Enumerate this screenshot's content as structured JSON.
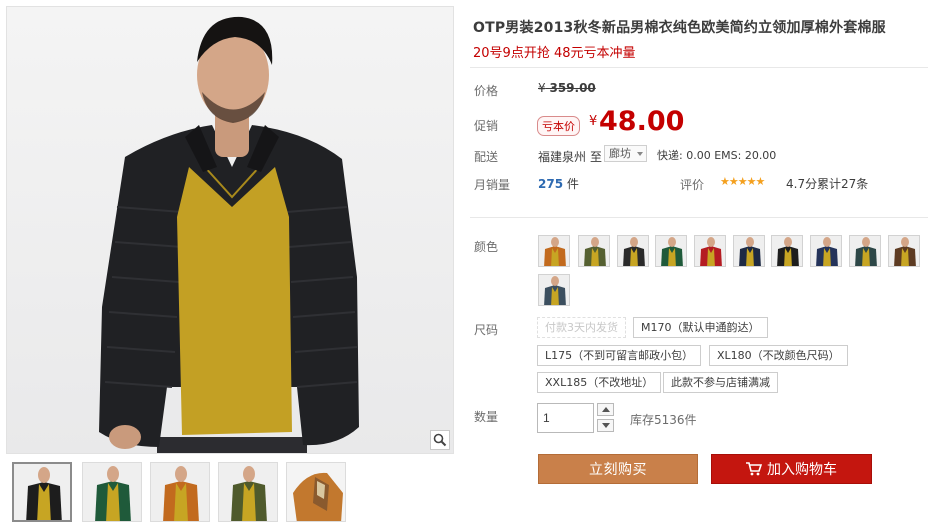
{
  "product": {
    "title": "OTP男装2013秋冬新品男棉衣纯色欧美简约立领加厚棉外套棉服",
    "subtitle": "20号9点开抢 48元亏本冲量"
  },
  "price": {
    "label": "价格",
    "original_currency": "¥",
    "original": "359.00",
    "promo_label": "促销",
    "promo_tag": "亏本价",
    "promo_currency": "¥",
    "promo": "48.00"
  },
  "shipping": {
    "label": "配送",
    "origin": "福建泉州",
    "to": "至",
    "destination": "廊坊",
    "fees": "快递: 0.00 EMS: 20.00"
  },
  "sales": {
    "label": "月销量",
    "count": "275",
    "unit": "件",
    "rating_label": "评价",
    "stars": 5,
    "rating": "4.7分",
    "reviews": "累计27条"
  },
  "colors": {
    "label": "颜色",
    "swatches": [
      {
        "name": "orange",
        "jacket": "#c26a1e"
      },
      {
        "name": "olive",
        "jacket": "#556031"
      },
      {
        "name": "black-camo",
        "jacket": "#2a2a2a"
      },
      {
        "name": "green",
        "jacket": "#1f5a3a"
      },
      {
        "name": "red",
        "jacket": "#b41c22"
      },
      {
        "name": "navy",
        "jacket": "#1e2a44"
      },
      {
        "name": "black",
        "jacket": "#1d1d1d"
      },
      {
        "name": "blue",
        "jacket": "#24335a"
      },
      {
        "name": "teal",
        "jacket": "#2d4747"
      },
      {
        "name": "brown",
        "jacket": "#5d3b22"
      },
      {
        "name": "slate",
        "jacket": "#3c4f5f"
      }
    ]
  },
  "sizes": {
    "label": "尺码",
    "options": [
      {
        "text": "付款3天内发货",
        "disabled": true
      },
      {
        "text": "M170（默认申通韵达）",
        "disabled": false
      },
      {
        "text": "L175（不到可留言邮政小包）",
        "disabled": false
      },
      {
        "text": "XL180（不改颜色尺码）",
        "disabled": false
      },
      {
        "text": "XXL185（不改地址）",
        "disabled": false
      },
      {
        "text": "此款不参与店铺满减",
        "disabled": false
      }
    ]
  },
  "quantity": {
    "label": "数量",
    "value": "1",
    "stock": "库存5136件"
  },
  "actions": {
    "buy_now": "立刻购买",
    "add_to_cart": "加入购物车"
  },
  "theme": {
    "price_red": "#c40000",
    "buy_button": "#c9804a",
    "cart_button": "#c4160f",
    "link_blue": "#2e6ab1",
    "star": "#f4a01e"
  },
  "gallery": {
    "thumbnails": [
      {
        "name": "black-jacket",
        "jacket": "#1d1d1d",
        "sweater": "#c7a523"
      },
      {
        "name": "green-jacket",
        "jacket": "#1f5a3a",
        "sweater": "#c7a523"
      },
      {
        "name": "orange-jacket",
        "jacket": "#c26a1e",
        "sweater": "#c7a523"
      },
      {
        "name": "olive-jacket",
        "jacket": "#4f5a2c",
        "sweater": "#c7a523"
      },
      {
        "name": "jacket-detail",
        "jacket": "#c2782e",
        "sweater": "#c7a523"
      }
    ]
  }
}
